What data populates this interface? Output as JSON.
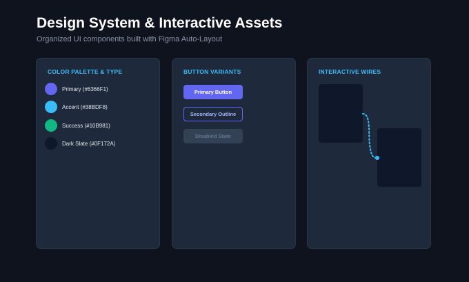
{
  "header": {
    "title": "Design System & Interactive Assets",
    "subtitle": "Organized UI components built with Figma Auto-Layout"
  },
  "palette_card": {
    "heading": "COLOR PALETTE & TYPE",
    "swatches": [
      {
        "label": "Primary (#6366F1)",
        "color": "#6366F1"
      },
      {
        "label": "Accent (#38BDF8)",
        "color": "#38BDF8"
      },
      {
        "label": "Success (#10B981)",
        "color": "#10B981"
      },
      {
        "label": "Dark Slate (#0F172A)",
        "color": "#0F172A"
      }
    ]
  },
  "buttons_card": {
    "heading": "BUTTON VARIANTS",
    "primary_label": "Primary Button",
    "secondary_label": "Secondary Outline",
    "disabled_label": "Disabled State"
  },
  "wires_card": {
    "heading": "INTERACTIVE WIRES",
    "wire_color": "#38BDF8"
  }
}
